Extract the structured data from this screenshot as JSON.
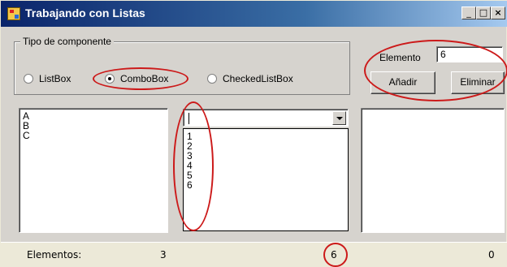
{
  "window": {
    "title": "Trabajando con Listas",
    "buttons": {
      "minimize": "_",
      "maximize": "□",
      "close": "×"
    }
  },
  "group": {
    "legend": "Tipo de componente",
    "options": [
      {
        "label": "ListBox",
        "checked": false
      },
      {
        "label": "ComboBox",
        "checked": true
      },
      {
        "label": "CheckedListBox",
        "checked": false
      }
    ]
  },
  "element": {
    "label": "Elemento",
    "value": "6",
    "add_label": "Añadir",
    "remove_label": "Eliminar"
  },
  "listbox": {
    "items": [
      "A",
      "B",
      "C"
    ]
  },
  "combobox": {
    "value": "",
    "items": [
      "1",
      "2",
      "3",
      "4",
      "5",
      "6"
    ]
  },
  "checkedlistbox": {
    "items": []
  },
  "status": {
    "label": "Elementos:",
    "listbox_count": "3",
    "combobox_count": "6",
    "checkedlist_count": "0"
  },
  "colors": {
    "annotation": "#cc1a1a",
    "titlebar_start": "#0a246a",
    "titlebar_end": "#a6caf0"
  }
}
